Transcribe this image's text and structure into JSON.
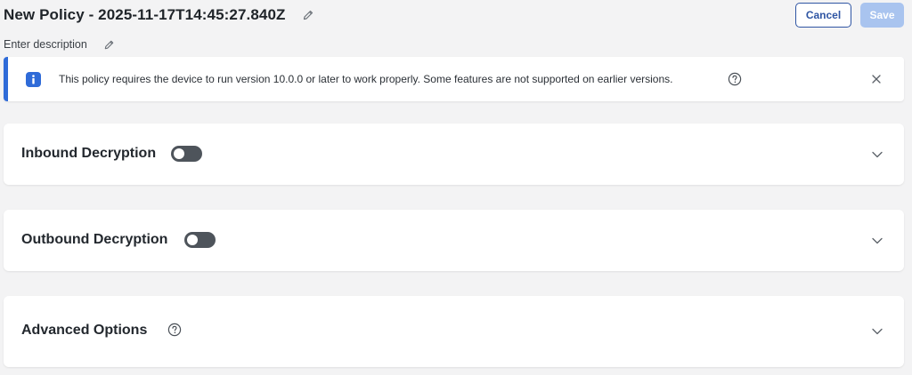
{
  "header": {
    "title": "New Policy - 2025-11-17T14:45:27.840Z",
    "description_placeholder": "Enter description",
    "cancel_label": "Cancel",
    "save_label": "Save"
  },
  "banner": {
    "message": "This policy requires the device to run version 10.0.0 or later to work properly. Some features are not supported on earlier versions.",
    "icon": "info-icon",
    "accent_color": "#2f6bd8"
  },
  "sections": [
    {
      "title": "Inbound Decryption",
      "toggle_on": false,
      "expanded": false
    },
    {
      "title": "Outbound Decryption",
      "toggle_on": false,
      "expanded": false
    },
    {
      "title": "Advanced Options",
      "has_help_icon": true,
      "expanded": false
    }
  ],
  "colors": {
    "primary": "#2f55a3",
    "save_disabled": "#a9c4ef",
    "toggle_off": "#4e545b",
    "background": "#f3f3f4"
  }
}
